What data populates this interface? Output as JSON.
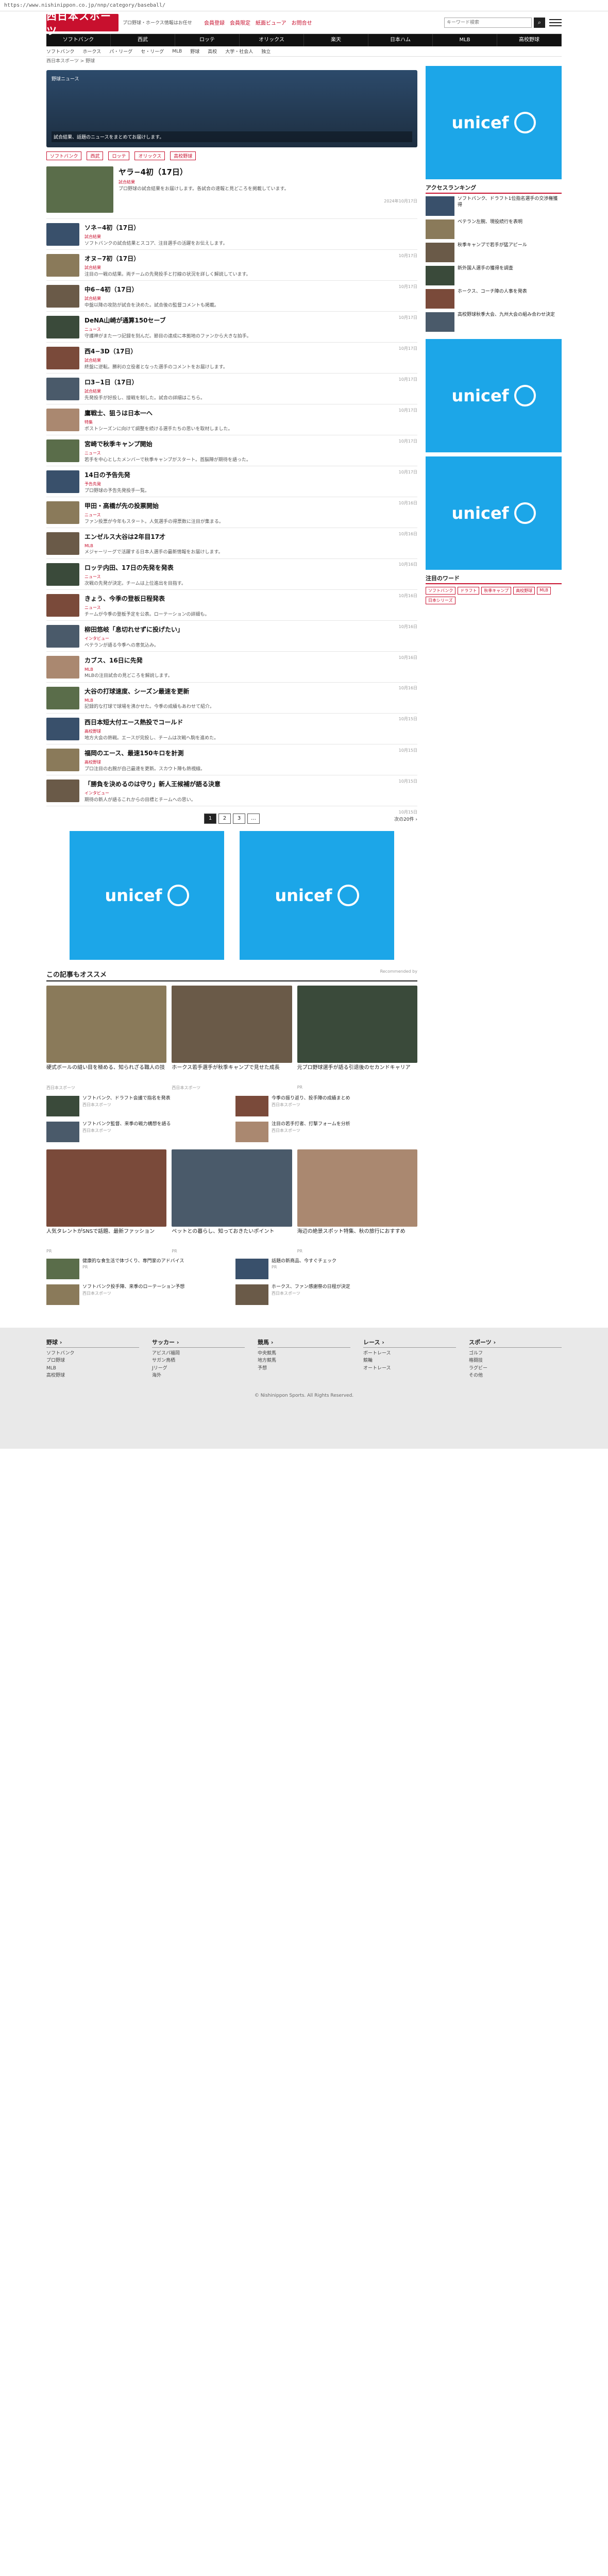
{
  "browser": {
    "url": "https://www.nishinippon.co.jp/nnp/category/baseball/"
  },
  "header": {
    "logo": "西日本スポーツ",
    "tagline": "プロ野球・ホークス情報はお任せ",
    "nav": [
      "会員登録",
      "会員限定",
      "紙面ビューア",
      "お問合せ"
    ],
    "search_placeholder": "キーワード検索",
    "search_button": "検索"
  },
  "gnav": [
    "ソフトバンク",
    "西武",
    "ロッテ",
    "オリックス",
    "楽天",
    "日本ハム",
    "MLB",
    "高校野球"
  ],
  "subnav": [
    "ソフトバンク",
    "ホークス",
    "パ・リーグ",
    "セ・リーグ",
    "MLB",
    "野球",
    "高校",
    "大学・社会人",
    "独立"
  ],
  "breadcrumb": "西日本スポーツ > 野球",
  "banner": {
    "label": "野球ニュース",
    "caption": "試合結果、話題のニュースをまとめてお届けします。"
  },
  "tags": [
    "ソフトバンク",
    "西武",
    "ロッテ",
    "オリックス",
    "高校野球"
  ],
  "articles": [
    {
      "title": "ヤラ−4初（17日）",
      "badge": "試合結果",
      "desc": "プロ野球の試合結果をお届けします。各試合の速報と見どころを掲載しています。",
      "date": "2024年10月17日",
      "big": true
    },
    {
      "title": "ソネ−4初（17日）",
      "badge": "試合結果",
      "desc": "ソフトバンクの試合結果とスコア、注目選手の活躍をお伝えします。",
      "date": "10月17日"
    },
    {
      "title": "オヌ−7初（17日）",
      "badge": "試合結果",
      "desc": "注目の一戦の結果。両チームの先発投手と打線の状況を詳しく解説しています。",
      "date": "10月17日"
    },
    {
      "title": "中6−4初（17日）",
      "badge": "試合結果",
      "desc": "中盤以降の攻防が試合を決めた。試合後の監督コメントも掲載。",
      "date": "10月17日"
    },
    {
      "title": "DeNA山崎が通算150セーブ",
      "badge": "ニュース",
      "desc": "守護神がまた一つ記録を刻んだ。節目の達成に本拠地のファンから大きな拍手。",
      "date": "10月17日"
    },
    {
      "title": "西4−3D（17日）",
      "badge": "試合結果",
      "desc": "終盤に逆転。勝利の立役者となった選手のコメントをお届けします。",
      "date": "10月17日"
    },
    {
      "title": "ロ3−1日（17日）",
      "badge": "試合結果",
      "desc": "先発投手が好投し、接戦を制した。試合の詳細はこちら。",
      "date": "10月17日"
    },
    {
      "title": "鷹戦士、狙うは日本一へ",
      "badge": "特集",
      "desc": "ポストシーズンに向けて調整を続ける選手たちの思いを取材しました。",
      "date": "10月17日"
    },
    {
      "title": "宮崎で秋季キャンプ開始",
      "badge": "ニュース",
      "desc": "若手を中心としたメンバーで秋季キャンプがスタート。首脳陣が期待を語った。",
      "date": "10月17日"
    },
    {
      "title": "14日の予告先発",
      "badge": "予告先発",
      "desc": "プロ野球の予告先発投手一覧。",
      "date": "10月16日"
    },
    {
      "title": "甲田・高橋が先の投票開始",
      "badge": "ニュース",
      "desc": "ファン投票が今年もスタート。人気選手の得票数に注目が集まる。",
      "date": "10月16日"
    },
    {
      "title": "エンゼルス大谷は2年目17才",
      "badge": "MLB",
      "desc": "メジャーリーグで活躍する日本人選手の最新情報をお届けします。",
      "date": "10月16日"
    },
    {
      "title": "ロッテ内田、17日の先発を発表",
      "badge": "ニュース",
      "desc": "次戦の先発が決定。チームは上位進出を目指す。",
      "date": "10月16日"
    },
    {
      "title": "きょう、今季の登板日程発表",
      "badge": "ニュース",
      "desc": "チームが今季の登板予定を公表。ローテーションの詳細も。",
      "date": "10月16日"
    },
    {
      "title": "柳田悠岐「息切れせずに投げたい」",
      "badge": "インタビュー",
      "desc": "ベテランが語る今季への意気込み。",
      "date": "10月16日"
    },
    {
      "title": "カブス、16日に先発",
      "badge": "MLB",
      "desc": "MLBの注目試合の見どころを解説します。",
      "date": "10月16日"
    },
    {
      "title": "大谷の打球速度、シーズン最速を更新",
      "badge": "MLB",
      "desc": "記録的な打球で球場を沸かせた。今季の成績もあわせて紹介。",
      "date": "10月15日"
    },
    {
      "title": "西日本短大付エース熱投でコールド",
      "badge": "高校野球",
      "desc": "地方大会の熱戦。エースが完投し、チームは次戦へ駒を進めた。",
      "date": "10月15日"
    },
    {
      "title": "福岡のエース、最速150キロを計測",
      "badge": "高校野球",
      "desc": "プロ注目の右腕が自己最速を更新。スカウト陣も熱視線。",
      "date": "10月15日"
    },
    {
      "title": "「勝負を決めるのは守り」新人王候補が語る決意",
      "badge": "インタビュー",
      "desc": "期待の新人が語るこれからの目標とチームへの思い。",
      "date": "10月15日"
    }
  ],
  "pager": {
    "pages": [
      "1",
      "2",
      "3",
      "…"
    ],
    "current": "1",
    "next": "次の20件 ›"
  },
  "ad": {
    "label": "unicef"
  },
  "recommend": {
    "title": "この記事もオススメ",
    "source": "Recommended by",
    "cards": [
      {
        "title": "硬式ボールの縫い目を極める、知られざる職人の技",
        "src": "西日本スポーツ"
      },
      {
        "title": "ホークス若手選手が秋季キャンプで見せた成長",
        "src": "西日本スポーツ"
      },
      {
        "title": "元プロ野球選手が語る引退後のセカンドキャリア",
        "src": "PR"
      },
      {
        "title": "人気タレントがSNSで話題、最新ファッション",
        "src": "PR"
      },
      {
        "title": "ペットとの暮らし、知っておきたいポイント",
        "src": "PR"
      },
      {
        "title": "海辺の絶景スポット特集、秋の旅行におすすめ",
        "src": "PR"
      }
    ],
    "list": [
      {
        "title": "ソフトバンク、ドラフト会議で指名を発表",
        "src": "西日本スポーツ"
      },
      {
        "title": "今季の振り返り、投手陣の成績まとめ",
        "src": "西日本スポーツ"
      },
      {
        "title": "ソフトバンク監督、来季の戦力構想を語る",
        "src": "西日本スポーツ"
      },
      {
        "title": "注目の若手打者、打撃フォームを分析",
        "src": "西日本スポーツ"
      },
      {
        "title": "健康的な食生活で体づくり、専門家のアドバイス",
        "src": "PR"
      },
      {
        "title": "話題の新商品、今すぐチェック",
        "src": "PR"
      },
      {
        "title": "ソフトバンク投手陣、来季のローテーション予想",
        "src": "西日本スポーツ"
      },
      {
        "title": "ホークス、ファン感謝祭の日程が決定",
        "src": "西日本スポーツ"
      }
    ]
  },
  "sidebar": {
    "ranking_title": "アクセスランキング",
    "ranking": [
      {
        "title": "ソフトバンク、ドラフト1位指名選手の交渉権獲得"
      },
      {
        "title": "ベテラン左腕、現役続行を表明"
      },
      {
        "title": "秋季キャンプで若手が猛アピール"
      },
      {
        "title": "新外国人選手の獲得を調査"
      },
      {
        "title": "ホークス、コーチ陣の人事を発表"
      },
      {
        "title": "高校野球秋季大会、九州大会の組み合わせ決定"
      }
    ],
    "tags_title": "注目のワード",
    "tags": [
      "ソフトバンク",
      "ドラフト",
      "秋季キャンプ",
      "高校野球",
      "MLB",
      "日本シリーズ"
    ]
  },
  "footer": {
    "cols": [
      {
        "head": "野球 ›",
        "links": [
          "ソフトバンク",
          "プロ野球",
          "MLB",
          "高校野球"
        ]
      },
      {
        "head": "サッカー ›",
        "links": [
          "アビスパ福岡",
          "サガン鳥栖",
          "Jリーグ",
          "海外"
        ]
      },
      {
        "head": "競馬 ›",
        "links": [
          "中央競馬",
          "地方競馬",
          "予想"
        ]
      },
      {
        "head": "レース ›",
        "links": [
          "ボートレース",
          "競輪",
          "オートレース"
        ]
      },
      {
        "head": "スポーツ ›",
        "links": [
          "ゴルフ",
          "格闘技",
          "ラグビー",
          "その他"
        ]
      }
    ],
    "copyright": "© Nishinippon Sports. All Rights Reserved."
  }
}
